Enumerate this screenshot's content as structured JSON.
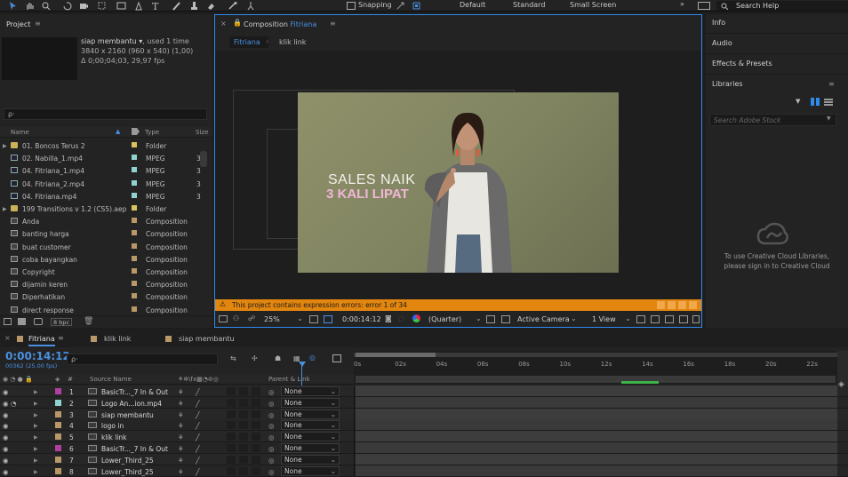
{
  "toolbar": {
    "snapping": "Snapping",
    "workspaces": [
      "Default",
      "Standard",
      "Small Screen"
    ],
    "search_help": "Search Help"
  },
  "project": {
    "title": "Project",
    "item_name": "siap membantu ▾",
    "used": ", used 1 time",
    "res": "3840 x 2160  (960 x 540) (1,00)",
    "dur": "Δ 0;00;04;03, 29,97 fps",
    "search_placeholder": "ρ·",
    "cols": {
      "name": "Name",
      "type": "Type",
      "size": "Size"
    },
    "items": [
      {
        "name": "01. Boncos Terus 2",
        "type": "Folder",
        "kind": "folder",
        "color": "#d9c35a",
        "size": "",
        "expand": true
      },
      {
        "name": "02. Nabilla_1.mp4",
        "type": "MPEG",
        "kind": "file",
        "color": "#8fd3d0",
        "size": "3"
      },
      {
        "name": "04. Fitriana_1.mp4",
        "type": "MPEG",
        "kind": "file",
        "color": "#8fd3d0",
        "size": "3"
      },
      {
        "name": "04. Fitriana_2.mp4",
        "type": "MPEG",
        "kind": "file",
        "color": "#8fd3d0",
        "size": "3"
      },
      {
        "name": "04. Fitriana.mp4",
        "type": "MPEG",
        "kind": "file",
        "color": "#8fd3d0",
        "size": "3"
      },
      {
        "name": "199 Transitions v 1.2 (CS5).aep",
        "type": "Folder",
        "kind": "folder",
        "color": "#d9c35a",
        "size": "",
        "expand": true
      },
      {
        "name": "Anda",
        "type": "Composition",
        "kind": "comp",
        "color": "#b89868",
        "size": ""
      },
      {
        "name": "banting harga",
        "type": "Composition",
        "kind": "comp",
        "color": "#b89868",
        "size": ""
      },
      {
        "name": "buat customer",
        "type": "Composition",
        "kind": "comp",
        "color": "#b89868",
        "size": ""
      },
      {
        "name": "coba bayangkan",
        "type": "Composition",
        "kind": "comp",
        "color": "#b89868",
        "size": ""
      },
      {
        "name": "Copyright",
        "type": "Composition",
        "kind": "comp",
        "color": "#b89868",
        "size": ""
      },
      {
        "name": "dijamin keren",
        "type": "Composition",
        "kind": "comp",
        "color": "#b89868",
        "size": ""
      },
      {
        "name": "Diperhatikan",
        "type": "Composition",
        "kind": "comp",
        "color": "#b89868",
        "size": ""
      },
      {
        "name": "direct response",
        "type": "Composition",
        "kind": "comp",
        "color": "#b89868",
        "size": ""
      }
    ],
    "bpc": "8 bpc"
  },
  "comp": {
    "title_prefix": "Composition",
    "title_name": "Fitriana",
    "tab_active": "Fitriana",
    "tab_other": "klik link",
    "overlay_line1": "SALES NAIK",
    "overlay_line2": "3 KALI LIPAT",
    "error": "This project contains expression errors: error 1 of 34",
    "zoom": "25%",
    "timecode": "0:00:14:12",
    "quality": "(Quarter)",
    "camera": "Active Camera",
    "view": "1 View"
  },
  "right": {
    "items": [
      "Info",
      "Audio",
      "Effects & Presets",
      "Libraries"
    ],
    "search_placeholder": "Search Adobe Stock",
    "message1": "To use Creative Cloud Libraries,",
    "message2": "please sign in to Creative Cloud"
  },
  "timeline": {
    "tabs": [
      "Fitriana",
      "klik link",
      "siap membantu"
    ],
    "timecode": "0:00:14:12",
    "frames": "00362 (25.00 fps)",
    "search_placeholder": "ρ·",
    "cols": {
      "source": "Source Name",
      "parent": "Parent & Link"
    },
    "ticks": [
      "0s",
      "02s",
      "04s",
      "06s",
      "08s",
      "10s",
      "12s",
      "14s",
      "16s",
      "18s",
      "20s",
      "22s"
    ],
    "layers": [
      {
        "num": "1",
        "name": "BasicTr..._7 In & Out",
        "color": "#b03fa0",
        "parent": "None",
        "audio": false
      },
      {
        "num": "2",
        "name": "Logo An...ion.mp4",
        "color": "#8fd3d0",
        "parent": "None",
        "audio": true
      },
      {
        "num": "3",
        "name": "siap membantu",
        "color": "#b89868",
        "parent": "None",
        "audio": false
      },
      {
        "num": "4",
        "name": "logo in",
        "color": "#b89868",
        "parent": "None",
        "audio": false
      },
      {
        "num": "5",
        "name": "klik link",
        "color": "#b89868",
        "parent": "None",
        "audio": false
      },
      {
        "num": "6",
        "name": "BasicTr..._7 In & Out",
        "color": "#b03fa0",
        "parent": "None",
        "audio": false
      },
      {
        "num": "7",
        "name": "Lower_Third_25",
        "color": "#b89868",
        "parent": "None",
        "audio": false
      },
      {
        "num": "8",
        "name": "Lower_Third_25",
        "color": "#b89868",
        "parent": "None",
        "audio": false
      }
    ]
  }
}
